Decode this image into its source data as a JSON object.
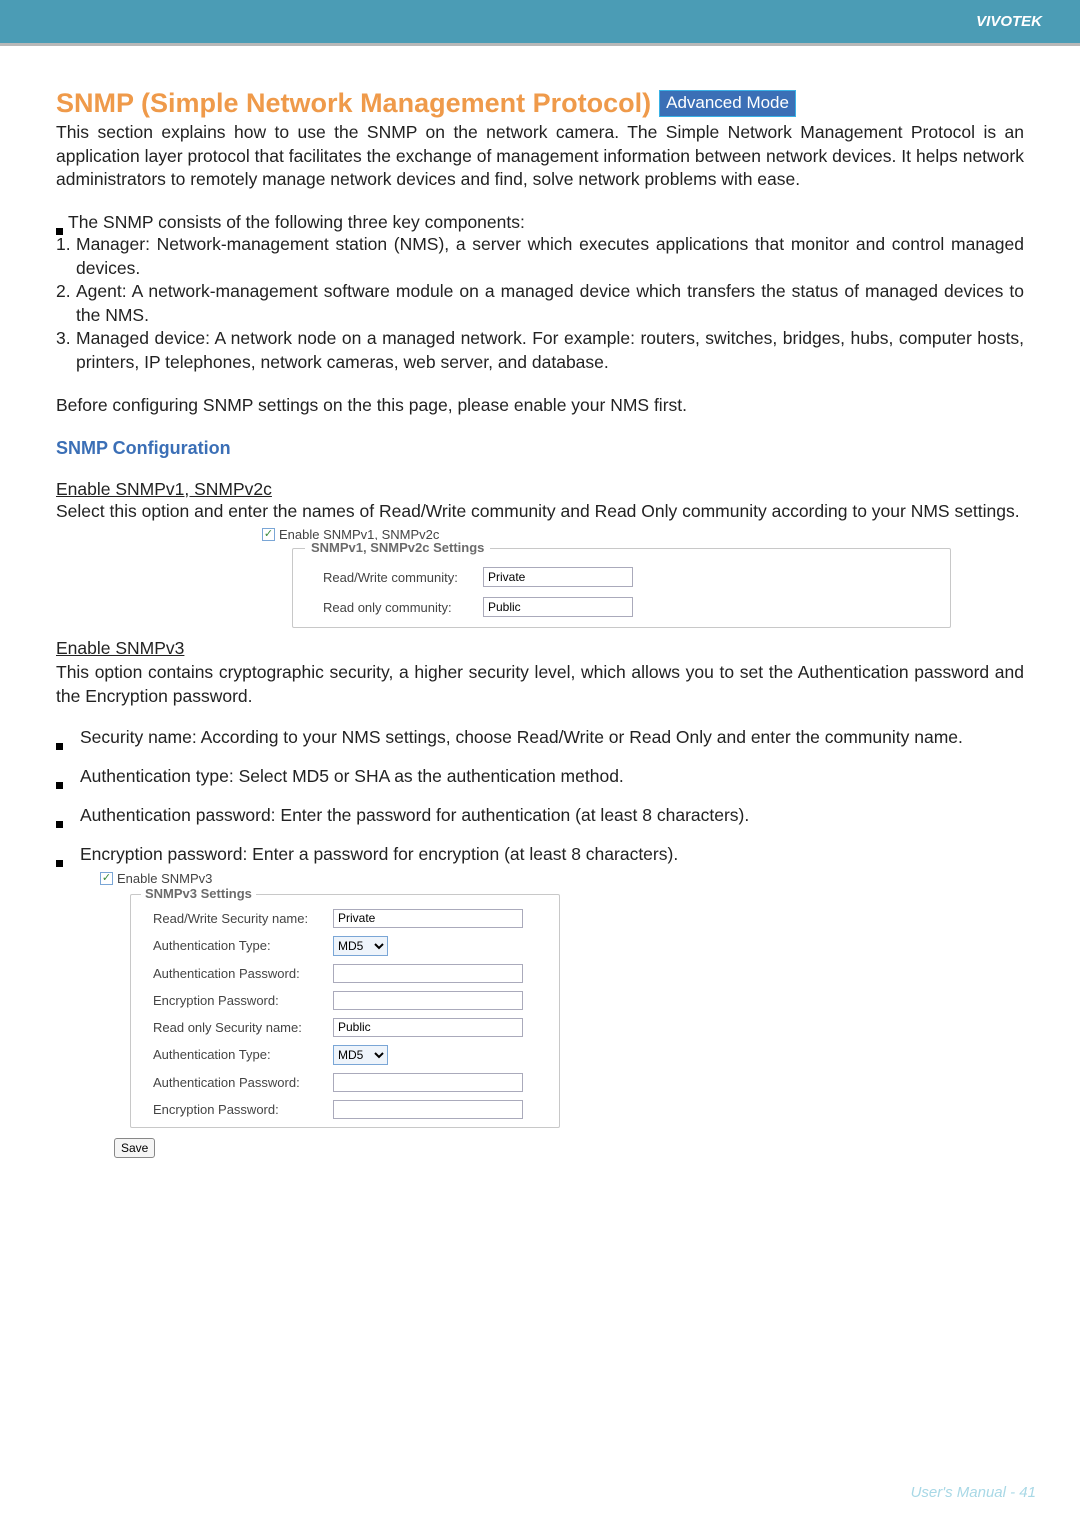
{
  "brand": "VIVOTEK",
  "title": "SNMP (Simple Network Management Protocol)",
  "badge": "Advanced Mode",
  "intro": "This section explains how to use the SNMP on the network camera. The Simple Network Management Protocol is an application layer protocol that facilitates the exchange of management information between network devices. It helps network administrators to remotely manage network devices and find, solve network problems with ease.",
  "components_lead": "The SNMP consists of the following three key components:",
  "components": [
    {
      "num": "1.",
      "text": "Manager: Network-management station (NMS), a server which executes applications that monitor and control managed devices."
    },
    {
      "num": "2.",
      "text": "Agent: A network-management software module on a managed device which transfers the status of managed devices to the NMS."
    },
    {
      "num": "3.",
      "text": "Managed device: A network node on a managed network. For example: routers, switches, bridges, hubs, computer hosts, printers, IP telephones, network cameras, web server, and database."
    }
  ],
  "before_conf": "Before configuring SNMP settings on the this page, please enable your NMS first.",
  "section_conf": "SNMP Configuration",
  "v12_head": "Enable SNMPv1, SNMPv2c",
  "v12_desc": "Select this option and enter the names of Read/Write community and Read Only community according to your NMS settings.",
  "shot1": {
    "checkbox_label": "Enable SNMPv1, SNMPv2c",
    "legend": "SNMPv1, SNMPv2c Settings",
    "rw_label": "Read/Write community:",
    "rw_value": "Private",
    "ro_label": "Read only community:",
    "ro_value": "Public"
  },
  "v3_head": "Enable SNMPv3",
  "v3_desc": "This option contains cryptographic security, a higher security level, which allows you to set the Authentication password and the Encryption password.",
  "v3_items": [
    "Security name: According to your NMS settings, choose Read/Write or Read Only and enter the community name.",
    "Authentication type: Select MD5 or SHA as the authentication method.",
    "Authentication password: Enter the password for authentication (at least 8 characters).",
    "Encryption password: Enter a password for encryption (at least 8 characters)."
  ],
  "shot2": {
    "checkbox_label": "Enable SNMPv3",
    "legend": "SNMPv3 Settings",
    "rows": {
      "rw_sec_label": "Read/Write Security name:",
      "rw_sec_value": "Private",
      "auth_type_label": "Authentication Type:",
      "auth_type_value": "MD5",
      "auth_pw_label": "Authentication Password:",
      "enc_pw_label": "Encryption Password:",
      "ro_sec_label": "Read only Security name:",
      "ro_sec_value": "Public"
    },
    "save": "Save"
  },
  "footer": "User's Manual - 41"
}
